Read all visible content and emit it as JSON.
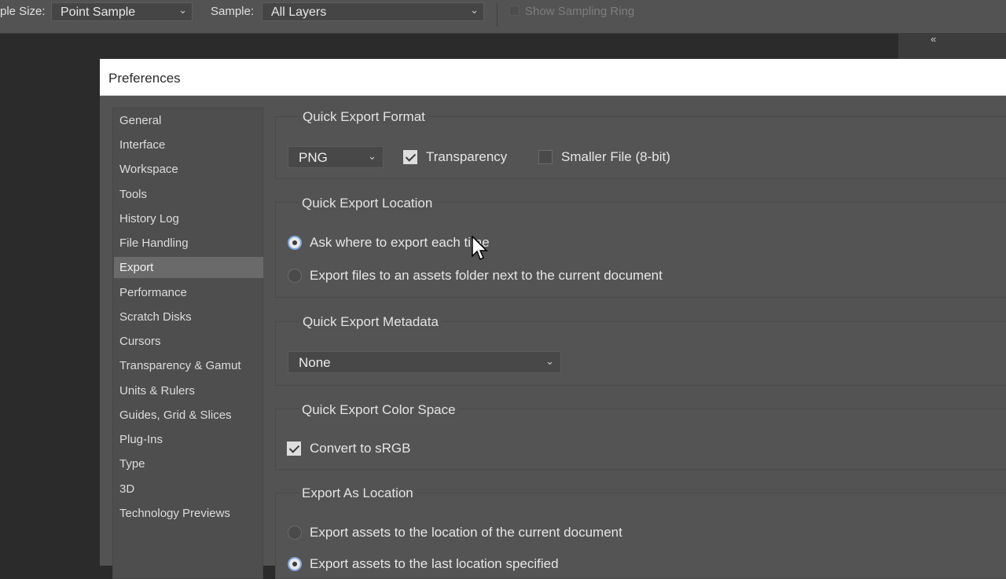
{
  "toolbar": {
    "sample_size_label": "ple Size:",
    "sample_size_value": "Point Sample",
    "sample_label": "Sample:",
    "sample_value": "All Layers",
    "show_sampling_ring_label": "Show Sampling Ring",
    "collapse_icon": "double-chevron-left-icon"
  },
  "dialog": {
    "title": "Preferences",
    "sidebar": {
      "items": [
        {
          "label": "General"
        },
        {
          "label": "Interface"
        },
        {
          "label": "Workspace"
        },
        {
          "label": "Tools"
        },
        {
          "label": "History Log"
        },
        {
          "label": "File Handling"
        },
        {
          "label": "Export",
          "selected": true
        },
        {
          "label": "Performance"
        },
        {
          "label": "Scratch Disks"
        },
        {
          "label": "Cursors"
        },
        {
          "label": "Transparency & Gamut"
        },
        {
          "label": "Units & Rulers"
        },
        {
          "label": "Guides, Grid & Slices"
        },
        {
          "label": "Plug-Ins"
        },
        {
          "label": "Type"
        },
        {
          "label": "3D"
        },
        {
          "label": "Technology Previews"
        }
      ]
    },
    "format": {
      "title": "Quick Export Format",
      "format_value": "PNG",
      "transparency_label": "Transparency",
      "transparency_checked": true,
      "smaller_file_label": "Smaller File (8-bit)",
      "smaller_file_checked": false
    },
    "location": {
      "title": "Quick Export Location",
      "ask_label": "Ask where to export each time",
      "assets_folder_label": "Export files to an assets folder next to the current document",
      "selected": "ask"
    },
    "metadata": {
      "title": "Quick Export Metadata",
      "value": "None"
    },
    "colorspace": {
      "title": "Quick Export Color Space",
      "convert_label": "Convert to sRGB",
      "convert_checked": true
    },
    "export_as_location": {
      "title": "Export As Location",
      "current_doc_label": "Export assets to the location of the current document",
      "last_location_label": "Export assets to the last location specified"
    }
  }
}
